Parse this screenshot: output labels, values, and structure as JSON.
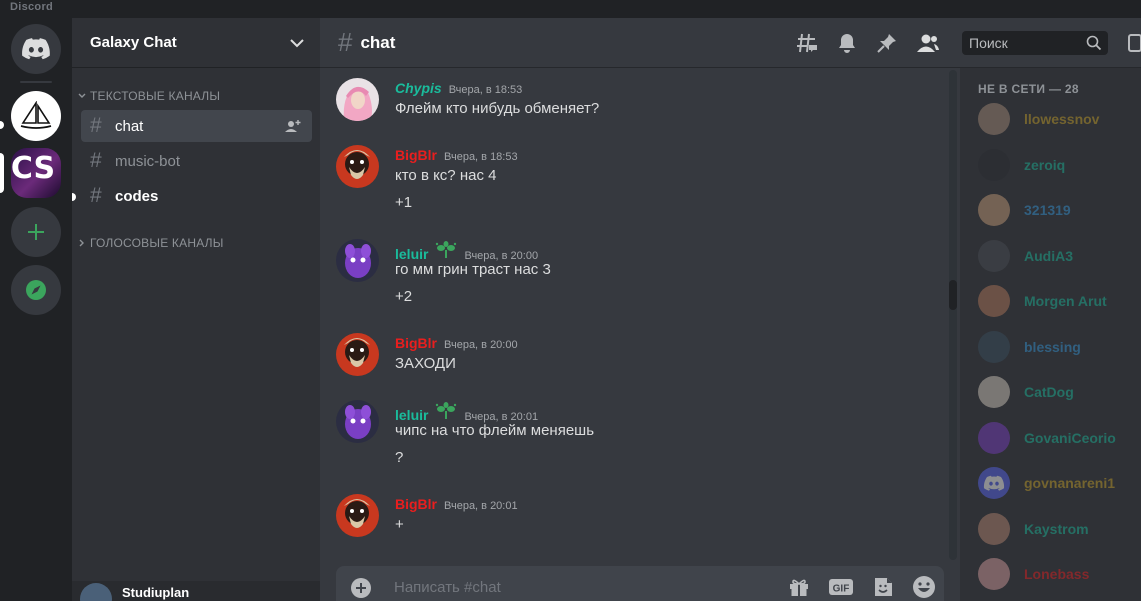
{
  "app": {
    "title": "Discord"
  },
  "guild": {
    "name": "Galaxy Chat",
    "letters": "CS"
  },
  "sidebar": {
    "categories": [
      {
        "label": "ТЕКСТОВЫЕ КАНАЛЫ"
      },
      {
        "label": "ГОЛОСОВЫЕ КАНАЛЫ"
      }
    ],
    "channels": [
      {
        "name": "chat",
        "state": "active"
      },
      {
        "name": "music-bot",
        "state": "muted"
      },
      {
        "name": "codes",
        "state": "unread"
      }
    ],
    "user": {
      "name": "Studiuplan"
    }
  },
  "header": {
    "channel": "chat",
    "search_placeholder": "Поиск"
  },
  "messages": [
    {
      "author": "Chypis",
      "color": "#1abc9c",
      "italic": true,
      "timestamp": "Вчера, в 18:53",
      "lines": [
        "Флейм кто нибудь обменяет?"
      ],
      "badge": false
    },
    {
      "author": "BigBlr",
      "color": "#e91e1e",
      "italic": false,
      "timestamp": "Вчера, в 18:53",
      "lines": [
        "кто в кс? нас 4",
        "+1"
      ],
      "badge": false
    },
    {
      "author": "leluir",
      "color": "#1abc9c",
      "italic": false,
      "timestamp": "Вчера, в 20:00",
      "lines": [
        "го мм грин траст нас 3",
        "+2"
      ],
      "badge": true
    },
    {
      "author": "BigBlr",
      "color": "#e91e1e",
      "italic": false,
      "timestamp": "Вчера, в 20:00",
      "lines": [
        "ЗАХОДИ"
      ],
      "badge": false
    },
    {
      "author": "leluir",
      "color": "#1abc9c",
      "italic": false,
      "timestamp": "Вчера, в 20:01",
      "lines": [
        "чипс на что флейм меняешь",
        "?"
      ],
      "badge": true
    },
    {
      "author": "BigBlr",
      "color": "#e91e1e",
      "italic": false,
      "timestamp": "Вчера, в 20:01",
      "lines": [
        "+"
      ],
      "badge": false
    }
  ],
  "composer": {
    "placeholder": "Написать #chat",
    "gif_label": "GIF"
  },
  "members": {
    "category": "НЕ В СЕТИ — 28",
    "list": [
      {
        "name": "llowessnov",
        "color": "#c9a227"
      },
      {
        "name": "zeroiq",
        "color": "#1abc9c"
      },
      {
        "name": "321319",
        "color": "#3498db"
      },
      {
        "name": "AudiA3",
        "color": "#1abc9c"
      },
      {
        "name": "Morgen Arut",
        "color": "#1abc9c"
      },
      {
        "name": "blessing",
        "color": "#3498db"
      },
      {
        "name": "CatDog",
        "color": "#1abc9c"
      },
      {
        "name": "GovaniCeorio",
        "color": "#1abc9c"
      },
      {
        "name": "govnanareni1",
        "color": "#c9a227"
      },
      {
        "name": "Kaystrom",
        "color": "#1abc9c"
      },
      {
        "name": "Lonebass",
        "color": "#e91e1e"
      }
    ]
  }
}
